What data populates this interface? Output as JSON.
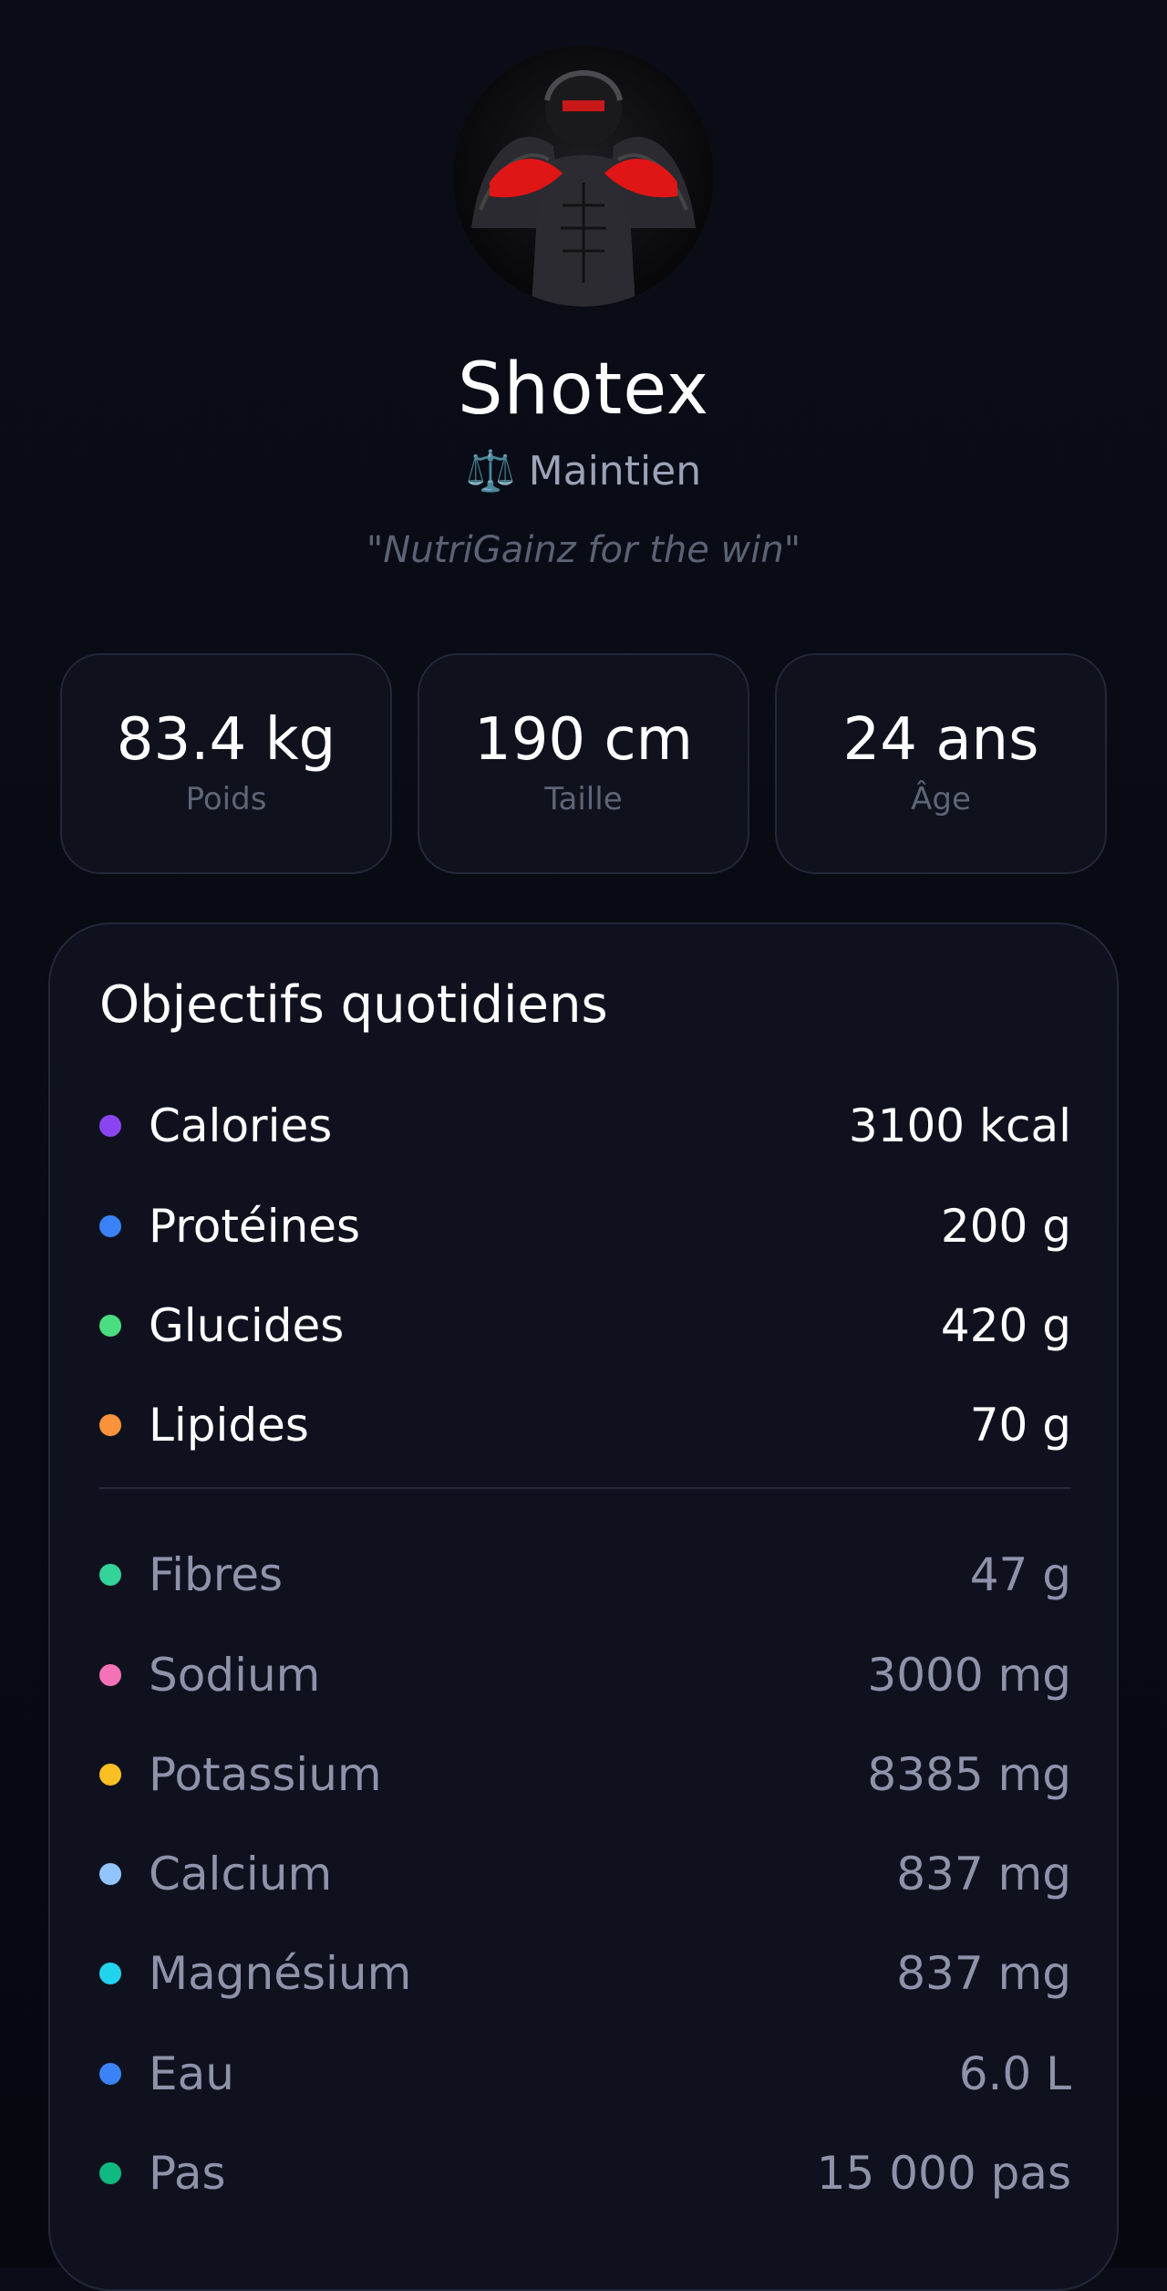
{
  "profile": {
    "username": "Shotex",
    "goal_icon": "⚖️",
    "goal_label": "Maintien",
    "motto": "\"NutriGainz for the win\""
  },
  "stats": [
    {
      "value": "83.4 kg",
      "label": "Poids"
    },
    {
      "value": "190 cm",
      "label": "Taille"
    },
    {
      "value": "24 ans",
      "label": "Âge"
    }
  ],
  "objectives": {
    "title": "Objectifs quotidiens",
    "primary": [
      {
        "label": "Calories",
        "value": "3100 kcal",
        "color": "#8b45f0"
      },
      {
        "label": "Protéines",
        "value": "200 g",
        "color": "#3b82f6"
      },
      {
        "label": "Glucides",
        "value": "420 g",
        "color": "#4ade80"
      },
      {
        "label": "Lipides",
        "value": "70 g",
        "color": "#fb923c"
      }
    ],
    "secondary": [
      {
        "label": "Fibres",
        "value": "47 g",
        "color": "#34d399"
      },
      {
        "label": "Sodium",
        "value": "3000 mg",
        "color": "#f472b6"
      },
      {
        "label": "Potassium",
        "value": "8385 mg",
        "color": "#fbbf24"
      },
      {
        "label": "Calcium",
        "value": "837 mg",
        "color": "#93c5fd"
      },
      {
        "label": "Magnésium",
        "value": "837 mg",
        "color": "#22d3ee"
      },
      {
        "label": "Eau",
        "value": "6.0 L",
        "color": "#3b82f6"
      },
      {
        "label": "Pas",
        "value": "15 000 pas",
        "color": "#10b981"
      }
    ]
  }
}
